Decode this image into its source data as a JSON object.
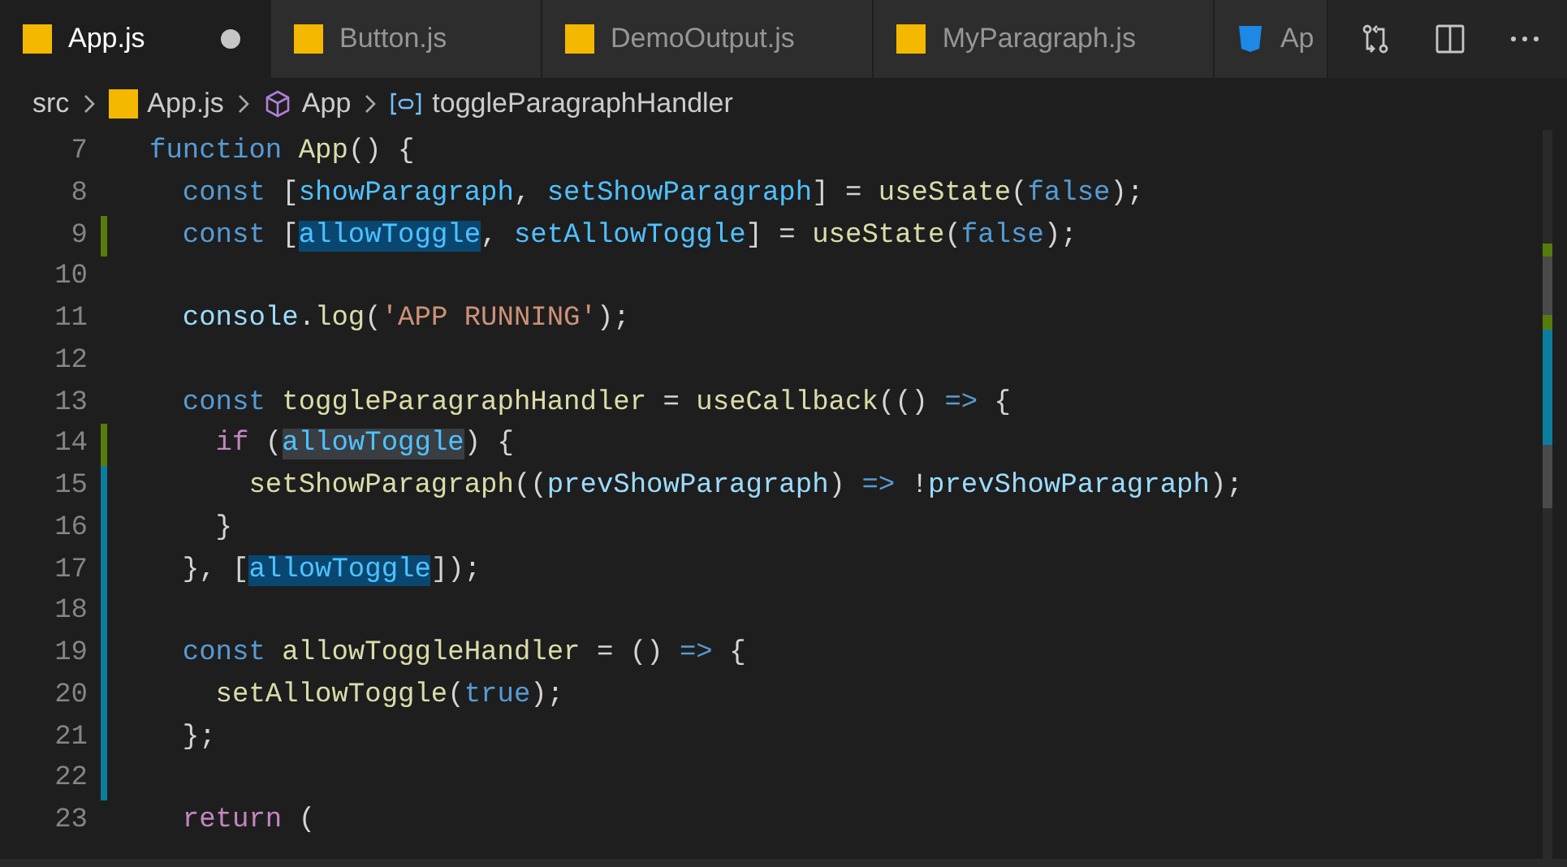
{
  "tabs": [
    {
      "label": "App.js",
      "kind": "js",
      "selected": true,
      "modified": true
    },
    {
      "label": "Button.js",
      "kind": "js",
      "selected": false,
      "modified": false
    },
    {
      "label": "DemoOutput.js",
      "kind": "js",
      "selected": false,
      "modified": false
    },
    {
      "label": "MyParagraph.js",
      "kind": "js",
      "selected": false,
      "modified": false
    },
    {
      "label": "Ap",
      "kind": "css",
      "selected": false
    }
  ],
  "breadcrumbs": [
    {
      "label": "src",
      "kind": "folder"
    },
    {
      "label": "App.js",
      "kind": "js"
    },
    {
      "label": "App",
      "kind": "component"
    },
    {
      "label": "toggleParagraphHandler",
      "kind": "variable"
    }
  ],
  "lines": [
    {
      "number": "7",
      "tokens": [
        {
          "text": "function ",
          "kind": "storage"
        },
        {
          "text": "App",
          "kind": "func"
        },
        {
          "text": "() {",
          "kind": "plain"
        }
      ]
    },
    {
      "number": "8",
      "tokens": [
        {
          "text": "  const",
          "kind": "storage"
        },
        {
          "text": " [",
          "kind": "plain"
        },
        {
          "text": "showParagraph",
          "kind": "const"
        },
        {
          "text": ", ",
          "kind": "plain"
        },
        {
          "text": "setShowParagraph",
          "kind": "const"
        },
        {
          "text": "] = ",
          "kind": "plain"
        },
        {
          "text": "useState",
          "kind": "func"
        },
        {
          "text": "(",
          "kind": "plain"
        },
        {
          "text": "false",
          "kind": "storage"
        },
        {
          "text": ");",
          "kind": "plain"
        }
      ]
    },
    {
      "number": "9",
      "color": "#587c0c",
      "tokens": [
        {
          "text": "  const",
          "kind": "storage"
        },
        {
          "text": " [",
          "kind": "plain"
        },
        {
          "text": "allowToggle",
          "kind": "const",
          "highlighted": true,
          "write_access": true
        },
        {
          "text": ", ",
          "kind": "plain"
        },
        {
          "text": "setAllowToggle",
          "kind": "const"
        },
        {
          "text": "] = ",
          "kind": "plain"
        },
        {
          "text": "useState",
          "kind": "func"
        },
        {
          "text": "(",
          "kind": "plain"
        },
        {
          "text": "false",
          "kind": "storage"
        },
        {
          "text": ");",
          "kind": "plain"
        }
      ]
    },
    {
      "number": "10"
    },
    {
      "number": "11",
      "tokens": [
        {
          "text": "  console",
          "kind": "var"
        },
        {
          "text": ".",
          "kind": "plain"
        },
        {
          "text": "log",
          "kind": "func"
        },
        {
          "text": "(",
          "kind": "plain"
        },
        {
          "text": "'APP RUNNING'",
          "kind": "string"
        },
        {
          "text": ");",
          "kind": "plain"
        }
      ]
    },
    {
      "number": "12"
    },
    {
      "number": "13",
      "tokens": [
        {
          "text": "  const ",
          "kind": "storage"
        },
        {
          "text": "toggleParagraphHandler",
          "kind": "func"
        },
        {
          "text": " = ",
          "kind": "plain"
        },
        {
          "text": "useCallback",
          "kind": "func"
        },
        {
          "text": "(() ",
          "kind": "plain"
        },
        {
          "text": "=>",
          "kind": "storage"
        },
        {
          "text": " {",
          "kind": "plain"
        }
      ]
    },
    {
      "number": "14",
      "color": "#587c0c",
      "tokens": [
        {
          "text": "    if",
          "kind": "control"
        },
        {
          "text": " (",
          "kind": "plain"
        },
        {
          "text": "allowToggle",
          "kind": "const",
          "highlighted": true,
          "write_access": false
        },
        {
          "text": ") {",
          "kind": "plain"
        }
      ]
    },
    {
      "number": "15",
      "color": "#0c7d9d",
      "tokens": [
        {
          "text": "      setShowParagraph",
          "kind": "func"
        },
        {
          "text": "((",
          "kind": "plain"
        },
        {
          "text": "prevShowParagraph",
          "kind": "var"
        },
        {
          "text": ") ",
          "kind": "plain"
        },
        {
          "text": "=>",
          "kind": "storage"
        },
        {
          "text": " !",
          "kind": "plain"
        },
        {
          "text": "prevShowParagraph",
          "kind": "var"
        },
        {
          "text": ");",
          "kind": "plain"
        }
      ]
    },
    {
      "number": "16",
      "color": "#0c7d9d",
      "tokens": [
        {
          "text": "    }",
          "kind": "plain"
        }
      ]
    },
    {
      "number": "17",
      "color": "#0c7d9d",
      "tokens": [
        {
          "text": "  }, [",
          "kind": "plain"
        },
        {
          "text": "allowToggle",
          "kind": "const",
          "highlighted": true,
          "write_access": true
        },
        {
          "text": "]);",
          "kind": "plain"
        }
      ]
    },
    {
      "number": "18",
      "color": "#0c7d9d"
    },
    {
      "number": "19",
      "color": "#0c7d9d",
      "tokens": [
        {
          "text": "  const ",
          "kind": "storage"
        },
        {
          "text": "allowToggleHandler",
          "kind": "func"
        },
        {
          "text": " = () ",
          "kind": "plain"
        },
        {
          "text": "=>",
          "kind": "storage"
        },
        {
          "text": " {",
          "kind": "plain"
        }
      ]
    },
    {
      "number": "20",
      "color": "#0c7d9d",
      "tokens": [
        {
          "text": "    setAllowToggle",
          "kind": "func"
        },
        {
          "text": "(",
          "kind": "plain"
        },
        {
          "text": "true",
          "kind": "storage"
        },
        {
          "text": ");",
          "kind": "plain"
        }
      ]
    },
    {
      "number": "21",
      "color": "#0c7d9d",
      "tokens": [
        {
          "text": "  };",
          "kind": "plain"
        }
      ]
    },
    {
      "number": "22",
      "color": "#0c7d9d"
    },
    {
      "number": "23",
      "tokens": [
        {
          "text": "  return",
          "kind": "control"
        },
        {
          "text": " (",
          "kind": "plain"
        }
      ]
    }
  ]
}
